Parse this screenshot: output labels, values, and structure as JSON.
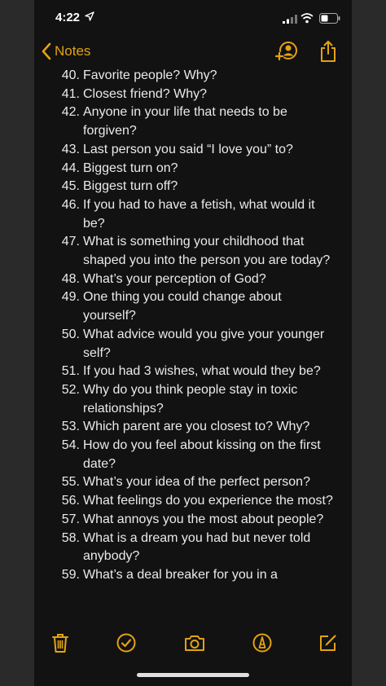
{
  "status_bar": {
    "time": "4:22",
    "icons": [
      "location-arrow-icon",
      "cellular-signal-icon",
      "wifi-icon",
      "battery-icon"
    ]
  },
  "nav": {
    "back_label": "Notes",
    "icons": [
      "back-chevron-icon",
      "add-person-icon",
      "share-icon"
    ]
  },
  "colors": {
    "accent": "#e3a312",
    "background": "#121212",
    "text": "#eaeaea"
  },
  "notes": {
    "items": [
      {
        "num": "40.",
        "text": "Favorite people? Why?"
      },
      {
        "num": "41.",
        "text": "Closest friend? Why?"
      },
      {
        "num": "42.",
        "text": "Anyone in your life that needs to be forgiven?"
      },
      {
        "num": "43.",
        "text": "Last person you said “I love you” to?"
      },
      {
        "num": "44.",
        "text": "Biggest turn on?"
      },
      {
        "num": "45.",
        "text": "Biggest turn off?"
      },
      {
        "num": "46.",
        "text": "If you had to have a fetish, what would it be?"
      },
      {
        "num": "47.",
        "text": "What is something your childhood that shaped you into the person you are today?"
      },
      {
        "num": "48.",
        "text": "What’s your perception of God?"
      },
      {
        "num": "49.",
        "text": "One thing you could change about yourself?"
      },
      {
        "num": "50.",
        "text": "What advice would you give your younger self?"
      },
      {
        "num": "51.",
        "text": "If you had 3 wishes, what would they be?"
      },
      {
        "num": "52.",
        "text": "Why do you think people stay in toxic relationships?"
      },
      {
        "num": "53.",
        "text": "Which parent are you closest to? Why?"
      },
      {
        "num": "54.",
        "text": "How do you feel about kissing on the first date?"
      },
      {
        "num": "55.",
        "text": "What’s your idea of the perfect person?"
      },
      {
        "num": "56.",
        "text": "What feelings do you experience the most?"
      },
      {
        "num": "57.",
        "text": "What annoys you the most about people?"
      },
      {
        "num": "58.",
        "text": "What is a dream you had but never told anybody?"
      },
      {
        "num": "59.",
        "text": "What’s a deal breaker for you in a"
      }
    ]
  },
  "toolbar": {
    "icons": [
      "trash-icon",
      "checklist-icon",
      "camera-icon",
      "markup-pen-icon",
      "compose-icon"
    ]
  }
}
